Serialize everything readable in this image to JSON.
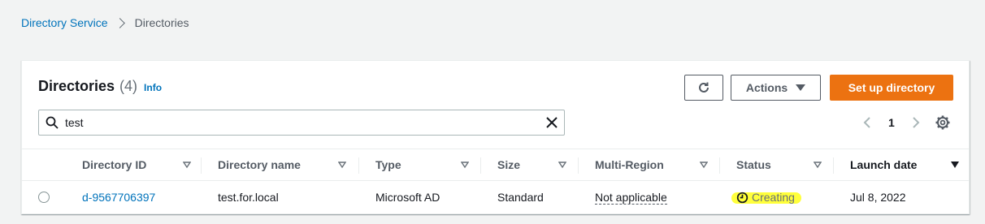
{
  "breadcrumb": {
    "items": [
      "Directory Service",
      "Directories"
    ]
  },
  "panel": {
    "title": "Directories",
    "count": "(4)",
    "info_label": "Info"
  },
  "toolbar": {
    "actions_label": "Actions",
    "setup_label": "Set up directory"
  },
  "search": {
    "value": "test"
  },
  "pagination": {
    "current_page": "1"
  },
  "table": {
    "columns": [
      "Directory ID",
      "Directory name",
      "Type",
      "Size",
      "Multi-Region",
      "Status",
      "Launch date"
    ],
    "rows": [
      {
        "directory_id": "d-9567706397",
        "directory_name": "test.for.local",
        "type": "Microsoft AD",
        "size": "Standard",
        "multi_region": "Not applicable",
        "status": "Creating",
        "launch_date": "Jul 8, 2022"
      }
    ]
  },
  "colors": {
    "link": "#0073bb",
    "primary_button": "#ec7211",
    "highlight": "#ffff26"
  },
  "icons": [
    "refresh-icon",
    "caret-down-icon",
    "search-icon",
    "clear-icon",
    "chevron-left-icon",
    "chevron-right-icon",
    "gear-icon",
    "sort-icon",
    "clock-icon"
  ]
}
